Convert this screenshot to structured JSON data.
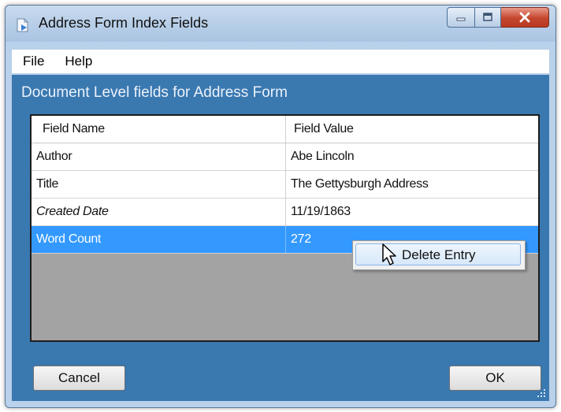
{
  "window": {
    "title": "Address Form Index Fields",
    "controls": [
      "minimize-icon",
      "maximize-icon",
      "close-icon"
    ],
    "close_color": "#c5452d"
  },
  "menu": {
    "items": [
      "File",
      "Help"
    ]
  },
  "section": {
    "label": "Document Level fields for Address Form"
  },
  "grid": {
    "headers": [
      "Field Name",
      "Field Value"
    ],
    "rows": [
      {
        "name": "Author",
        "value": "Abe Lincoln"
      },
      {
        "name": "Title",
        "value": "The Gettysburgh Address"
      },
      {
        "name": "Created Date",
        "value": "11/19/1863"
      },
      {
        "name": "Word Count",
        "value": "272"
      }
    ],
    "selected_color": "#3399ff"
  },
  "context_menu": {
    "items": [
      "Delete Entry"
    ]
  },
  "buttons": {
    "cancel": "Cancel",
    "ok": "OK"
  },
  "colors": {
    "client_bg": "#3a78b0",
    "grid_empty_bg": "#a3a3a3"
  }
}
